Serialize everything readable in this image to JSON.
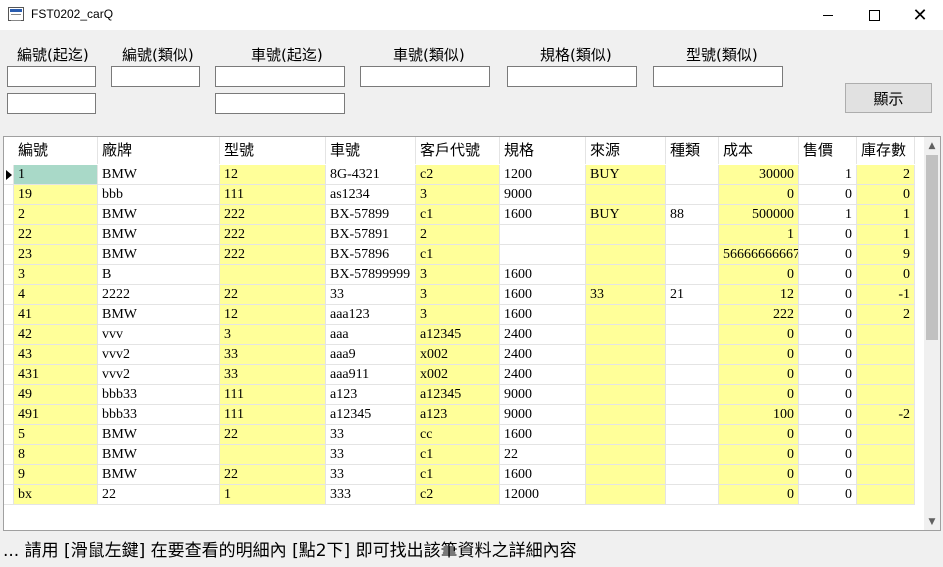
{
  "window": {
    "title": "FST0202_carQ",
    "icon": "app-window-icon",
    "controls": [
      "minimize-icon",
      "maximize-icon",
      "close-icon"
    ]
  },
  "filters": {
    "labels": [
      "編號(起迄)",
      "編號(類似)",
      "車號(起迄)",
      "車號(類似)",
      "規格(類似)",
      "型號(類似)"
    ],
    "values": {
      "id_from": "",
      "id_to": "",
      "id_like": "",
      "plate_from": "",
      "plate_to": "",
      "plate_like": "",
      "spec_like": "",
      "model_like": ""
    },
    "show_button": "顯示"
  },
  "grid": {
    "columns": [
      "編號",
      "廠牌",
      "型號",
      "車號",
      "客戶代號",
      "規格",
      "來源",
      "種類",
      "成本",
      "售價",
      "庫存數"
    ],
    "rows": [
      [
        "1",
        "BMW",
        "12",
        "8G-4321",
        "c2",
        "1200",
        "BUY",
        "",
        "30000",
        "1",
        "2"
      ],
      [
        "19",
        "bbb",
        "111",
        "as1234",
        "3",
        "9000",
        "",
        "",
        "0",
        "0",
        "0"
      ],
      [
        "2",
        "BMW",
        "222",
        "BX-57899",
        "c1",
        "1600",
        "BUY",
        "88",
        "500000",
        "1",
        "1"
      ],
      [
        "22",
        "BMW",
        "222",
        "BX-57891",
        "2",
        "",
        "",
        "",
        "1",
        "0",
        "1"
      ],
      [
        "23",
        "BMW",
        "222",
        "BX-57896",
        "c1",
        "",
        "",
        "",
        "56666666667",
        "0",
        "9"
      ],
      [
        "3",
        "B",
        "",
        "BX-57899999",
        "3",
        "1600",
        "",
        "",
        "0",
        "0",
        "0"
      ],
      [
        "4",
        "2222",
        "22",
        "33",
        "3",
        "1600",
        "33",
        "21",
        "12",
        "0",
        "-1"
      ],
      [
        "41",
        "BMW",
        "12",
        "aaa123",
        "3",
        "1600",
        "",
        "",
        "222",
        "0",
        "2"
      ],
      [
        "42",
        "vvv",
        "3",
        "aaa",
        "a12345",
        "2400",
        "",
        "",
        "0",
        "0",
        ""
      ],
      [
        "43",
        "vvv2",
        "33",
        "aaa9",
        "x002",
        "2400",
        "",
        "",
        "0",
        "0",
        ""
      ],
      [
        "431",
        "vvv2",
        "33",
        "aaa911",
        "x002",
        "2400",
        "",
        "",
        "0",
        "0",
        ""
      ],
      [
        "49",
        "bbb33",
        "111",
        "a123",
        "a12345",
        "9000",
        "",
        "",
        "0",
        "0",
        ""
      ],
      [
        "491",
        "bbb33",
        "111",
        "a12345",
        "a123",
        "9000",
        "",
        "",
        "100",
        "0",
        "-2"
      ],
      [
        "5",
        "BMW",
        "22",
        "33",
        "cc",
        "1600",
        "",
        "",
        "0",
        "0",
        ""
      ],
      [
        "8",
        "BMW",
        "",
        "33",
        "c1",
        "22",
        "",
        "",
        "0",
        "0",
        ""
      ],
      [
        "9",
        "BMW",
        "22",
        "33",
        "c1",
        "1600",
        "",
        "",
        "0",
        "0",
        ""
      ],
      [
        "bx",
        "22",
        "1",
        "333",
        "c2",
        "12000",
        "",
        "",
        "0",
        "0",
        ""
      ]
    ],
    "selected_row": 0,
    "highlight_color": "#ffff99",
    "selection_color": "#a9d9c8"
  },
  "status": "... 請用 [滑鼠左鍵]  在要查看的明細內 [點2下]  即可找出該筆資料之詳細內容"
}
